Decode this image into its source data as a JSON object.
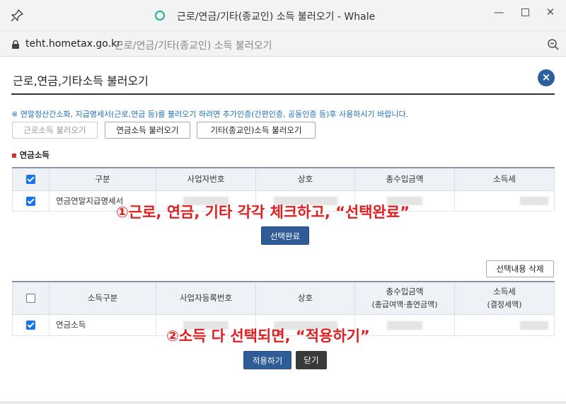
{
  "window": {
    "title": "근로/연금/기타(종교인) 소득 불러오기 - Whale",
    "minimize": "—",
    "close": "✕"
  },
  "address": {
    "host": "teht.hometax.go.kr",
    "page_title": "근로/연금/기타(종교인) 소득 불러오기"
  },
  "dialog": {
    "title": "근로,연금,기타소득 불러오기",
    "close_glyph": "×",
    "notice": "※ 연말정산간소화, 지급명세서(근로,연금 등)를 불러오기 하려면 추가인증(간편인증, 공동인증 등)후 사용하시기 바랍니다.",
    "buttons": {
      "wage": "근로소득 불러오기",
      "pension": "연금소득 불러오기",
      "other": "기타(종교인)소득 불러오기"
    },
    "section_label": "연금소득"
  },
  "table1": {
    "headers": [
      "구분",
      "사업자번호",
      "상호",
      "총수입금액",
      "소득세"
    ],
    "rows": [
      {
        "checked": true,
        "category": "연금연말지급명세서"
      }
    ]
  },
  "select_button": "선택완료",
  "delete_button": "선택내용 삭제",
  "table2": {
    "headers": [
      "소득구분",
      "사업자등록번호",
      "상호",
      "총수입금액",
      "소득세"
    ],
    "subheaders": {
      "total": "(총급여액·총연금액)",
      "tax": "(결정세액)"
    },
    "rows": [
      {
        "checked": true,
        "category": "연금소득"
      }
    ]
  },
  "apply_button": "적용하기",
  "close_button": "닫기",
  "annotations": {
    "step1": "①근로, 연금, 기타 각각 체크하고, “선택완료”",
    "step2": "②소득 다 선택되면, “적용하기”"
  },
  "colors": {
    "accent": "#2f5c96",
    "annotation": "#e02020",
    "notice": "#1f6fb5",
    "checkbox": "#1a73e8"
  }
}
